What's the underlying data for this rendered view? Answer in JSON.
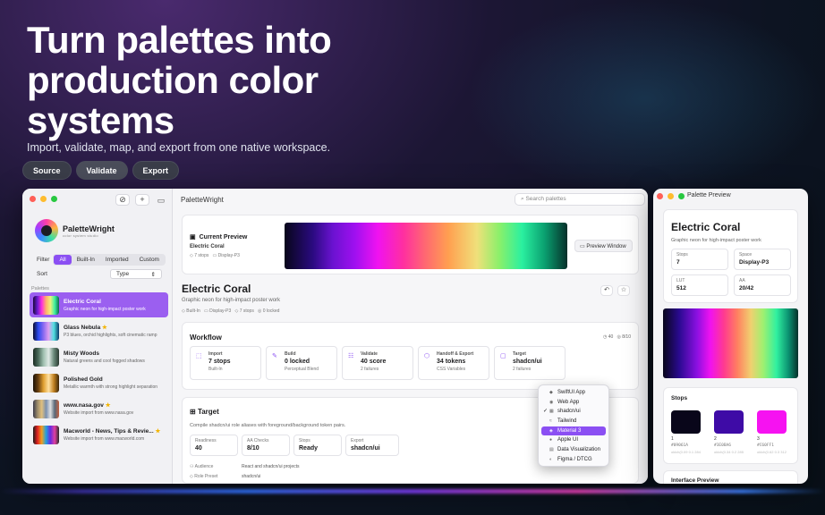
{
  "hero": {
    "title": "Turn palettes into production color systems",
    "subtitle": "Import, validate, map, and export from one native workspace.",
    "chips": [
      "Source",
      "Validate",
      "Export"
    ]
  },
  "app": {
    "title": "PaletteWright",
    "logo_sub": "color system studio",
    "search_placeholder": "Search palettes",
    "toolbar": {
      "add": "+",
      "filter": "⊘",
      "sidebar": "▭"
    }
  },
  "sidebar": {
    "filter_label": "Filter",
    "filters": [
      "All",
      "Built-In",
      "Imported",
      "Custom"
    ],
    "selected_filter": "All",
    "sort_label": "Sort",
    "sort_value": "Type",
    "section_label": "Palettes",
    "palettes": [
      {
        "name": "Electric Coral",
        "desc": "Graphic neon for high-impact poster work",
        "starred": false,
        "selected": true
      },
      {
        "name": "Glass Nebula",
        "desc": "P3 blues, orchid highlights, soft cinematic ramp",
        "starred": true,
        "selected": false
      },
      {
        "name": "Misty Woods",
        "desc": "Natural greens and cool fogged shadows",
        "starred": false,
        "selected": false
      },
      {
        "name": "Polished Gold",
        "desc": "Metallic warmth with strong highlight separation",
        "starred": false,
        "selected": false
      },
      {
        "name": "www.nasa.gov",
        "desc": "Website import from www.nasa.gov",
        "starred": true,
        "selected": false
      },
      {
        "name": "Macworld - News, Tips & Revie...",
        "desc": "Website import from www.macworld.com",
        "starred": true,
        "selected": false
      }
    ]
  },
  "preview": {
    "heading": "Current Preview",
    "name": "Electric Coral",
    "stops": "7 stops",
    "space": "Display-P3",
    "button": "Preview Window"
  },
  "detail": {
    "title": "Electric Coral",
    "desc": "Graphic neon for high-impact poster work",
    "meta": [
      "Built-In",
      "Display-P3",
      "7 stops",
      "0 locked"
    ]
  },
  "workflow": {
    "title": "Workflow",
    "right": [
      "40",
      "8/10"
    ],
    "tiles": [
      {
        "icon": "import-icon",
        "label": "Import",
        "value": "7 stops",
        "sub": "Built-In"
      },
      {
        "icon": "build-icon",
        "label": "Build",
        "value": "0 locked",
        "sub": "Perceptual Blend"
      },
      {
        "icon": "validate-icon",
        "label": "Validate",
        "value": "40 score",
        "sub": "2 failures"
      },
      {
        "icon": "handoff-icon",
        "label": "Handoff & Export",
        "value": "34 tokens",
        "sub": "CSS Variables"
      },
      {
        "icon": "target-icon",
        "label": "Target",
        "value": "shadcn/ui",
        "sub": "2 failures"
      }
    ]
  },
  "target": {
    "title": "Target",
    "desc": "Compile shadcn/ui role aliases with foreground/background token pairs.",
    "tiles": [
      {
        "label": "Readiness",
        "value": "40"
      },
      {
        "label": "AA Checks",
        "value": "8/10"
      },
      {
        "label": "Stops",
        "value": "Ready"
      },
      {
        "label": "Export",
        "value": "shadcn/ui"
      }
    ],
    "rows": [
      {
        "k": "Audience",
        "v": "React and shadcn/ui projects"
      },
      {
        "k": "Role Preset",
        "v": "shadcn/ui"
      }
    ]
  },
  "target_menu": {
    "items": [
      "SwiftUI App",
      "Web App",
      "shadcn/ui",
      "Tailwind",
      "Material 3",
      "Apple UI",
      "Data Visualization",
      "Figma / DTCG"
    ],
    "checked": "shadcn/ui",
    "highlighted": "Material 3"
  },
  "preview_window": {
    "title": "Palette Preview",
    "name": "Electric Coral",
    "desc": "Graphic neon for high-impact poster work",
    "cells": [
      {
        "label": "Stops",
        "value": "7"
      },
      {
        "label": "Space",
        "value": "Display-P3"
      },
      {
        "label": "LUT",
        "value": "512"
      },
      {
        "label": "AA",
        "value": "20/42"
      }
    ],
    "stops_title": "Stops",
    "stops": [
      {
        "n": "1",
        "hex": "#09061A",
        "sub": "oklch(0.09 0.1 284)",
        "color": "#09061a"
      },
      {
        "n": "2",
        "hex": "#3E0BA6",
        "sub": "oklch(0.34 0.2 285)",
        "color": "#3e0ba6"
      },
      {
        "n": "3",
        "hex": "#C60FF1",
        "sub": "oklch(0.62 0.3 312)",
        "color": "#f612f1"
      }
    ],
    "interface_title": "Interface Preview"
  },
  "colors": {
    "accent": "#8b4ff3",
    "star": "#f2b400"
  }
}
